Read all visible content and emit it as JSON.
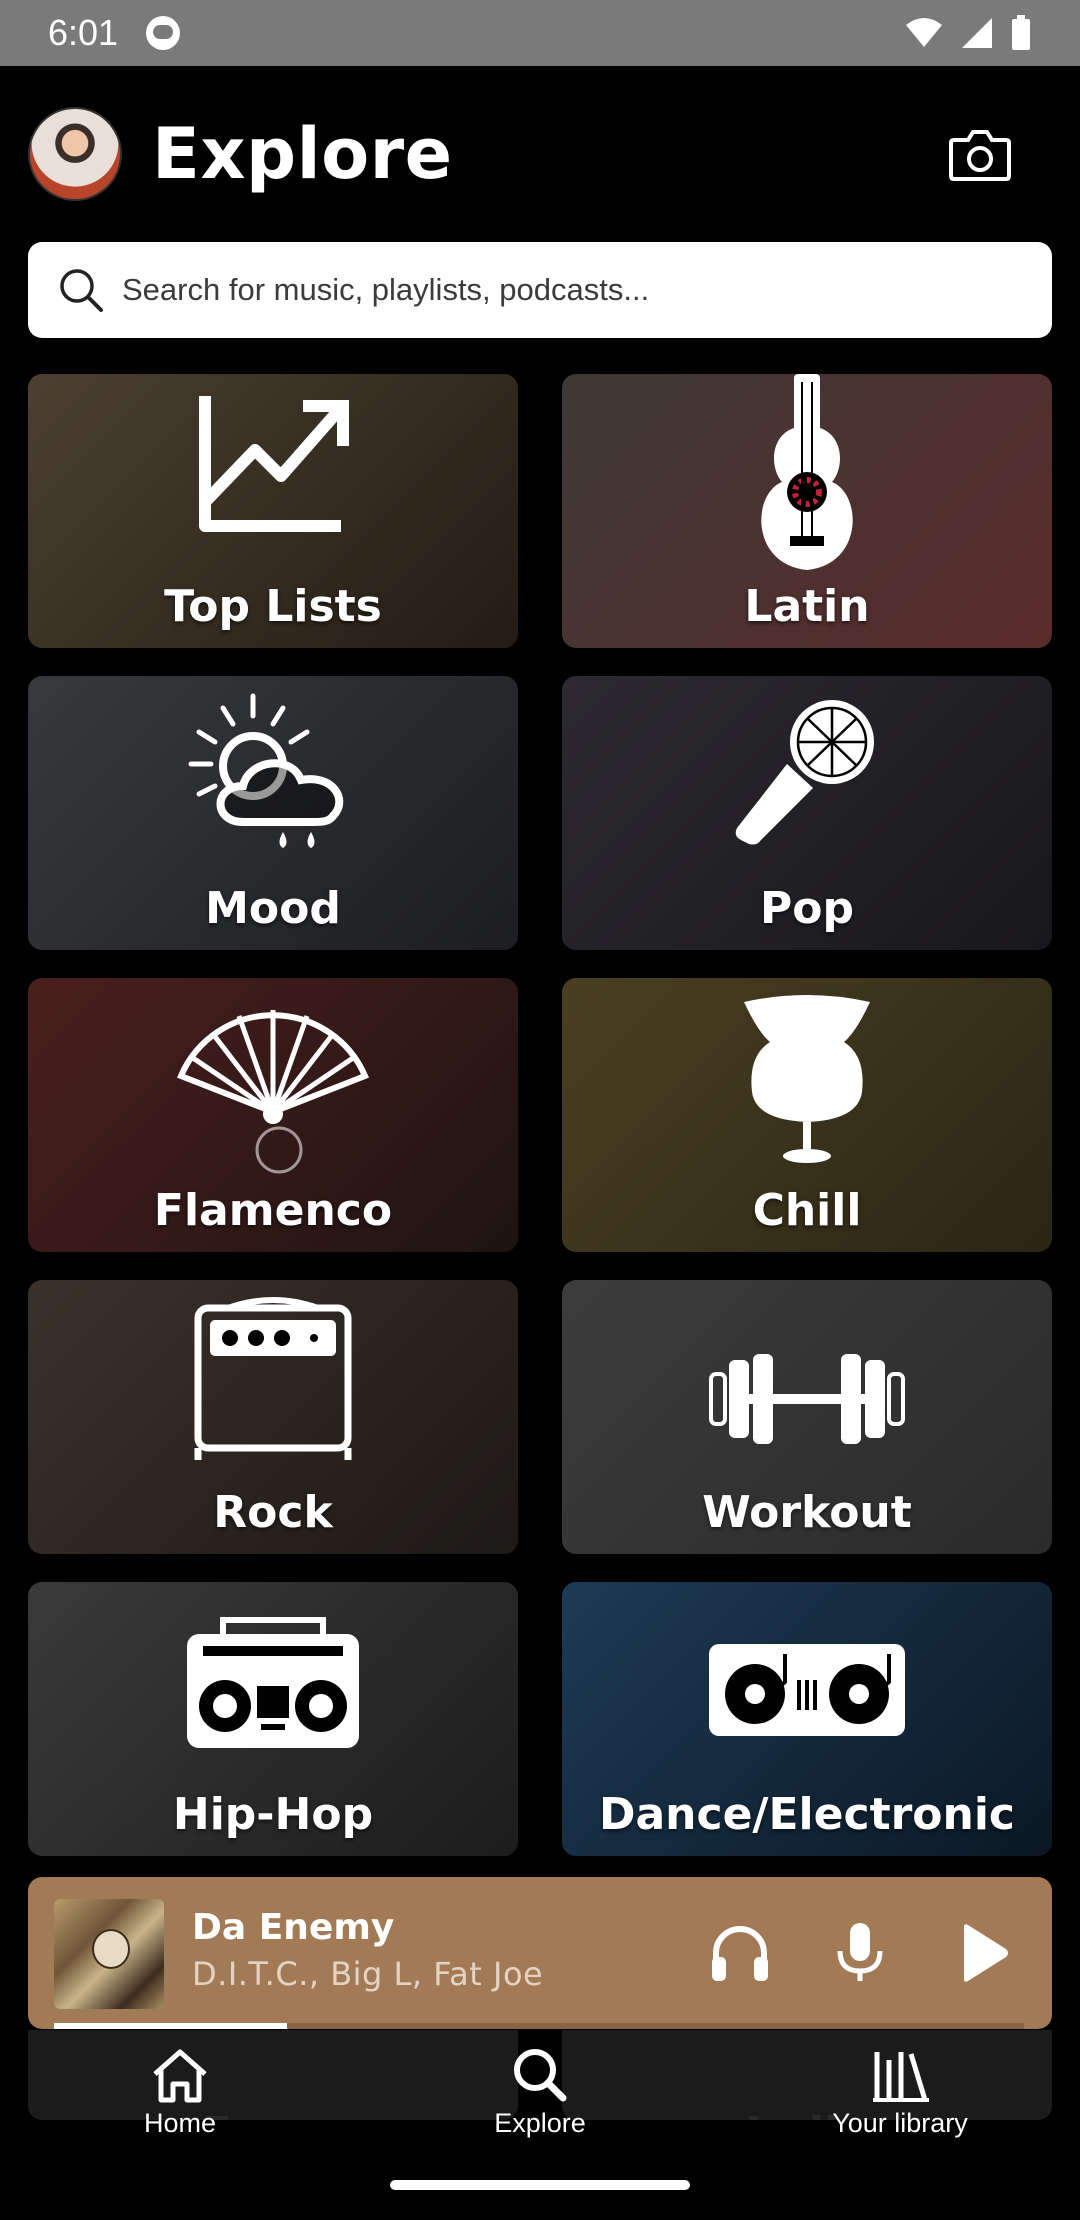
{
  "status_bar": {
    "time": "6:01"
  },
  "header": {
    "title": "Explore"
  },
  "search": {
    "placeholder": "Search for music, playlists, podcasts..."
  },
  "categories": [
    {
      "label": "Top Lists",
      "icon": "trending-up-icon",
      "bg": [
        "#4b4030",
        "#221c14"
      ]
    },
    {
      "label": "Latin",
      "icon": "guitar-icon",
      "bg": [
        "#3d3935",
        "#5a2b2b"
      ]
    },
    {
      "label": "Mood",
      "icon": "weather-icon",
      "bg": [
        "#37393d",
        "#1c1d20"
      ]
    },
    {
      "label": "Pop",
      "icon": "microphone-icon",
      "bg": [
        "#2c2a30",
        "#18171b"
      ]
    },
    {
      "label": "Flamenco",
      "icon": "fan-icon",
      "bg": [
        "#4a1f1d",
        "#1e1412"
      ]
    },
    {
      "label": "Chill",
      "icon": "egg-chair-icon",
      "bg": [
        "#4a3f22",
        "#2a2514"
      ]
    },
    {
      "label": "Rock",
      "icon": "amplifier-icon",
      "bg": [
        "#3a312b",
        "#1d1916"
      ]
    },
    {
      "label": "Workout",
      "icon": "dumbbell-icon",
      "bg": [
        "#3c3c3c",
        "#2a2a2a"
      ]
    },
    {
      "label": "Hip-Hop",
      "icon": "boombox-icon",
      "bg": [
        "#3a3a3a",
        "#1c1c1c"
      ]
    },
    {
      "label": "Dance/Electronic",
      "icon": "turntable-icon",
      "bg": [
        "#1d3a55",
        "#0b1824"
      ]
    }
  ],
  "now_playing": {
    "title": "Da Enemy",
    "artist": "D.I.T.C., Big L, Fat Joe",
    "progress": 0.24,
    "bg_color": "#a27a56"
  },
  "peek_tiles": [
    "Focus",
    "Indie"
  ],
  "nav": {
    "items": [
      {
        "label": "Home",
        "icon": "home-icon"
      },
      {
        "label": "Explore",
        "icon": "explore-icon",
        "active": true
      },
      {
        "label": "Your library",
        "icon": "library-icon"
      }
    ]
  }
}
